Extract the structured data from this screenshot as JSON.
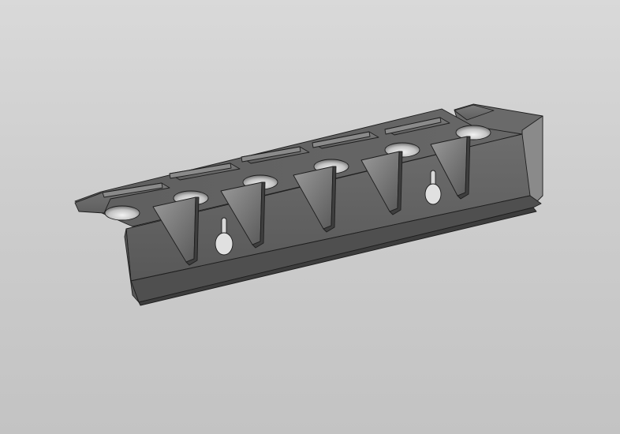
{
  "viewport": {
    "background_top": "#d9d9d9",
    "background_bottom": "#c3c3c3"
  },
  "model": {
    "type": "3d-part",
    "shading": "shaded-with-edges",
    "body_color": "#6e6e6e",
    "edge_color": "#1e1e1e",
    "feature_counts": {
      "brackets": 5,
      "holes": 6,
      "keyhole_slots": 2
    }
  }
}
